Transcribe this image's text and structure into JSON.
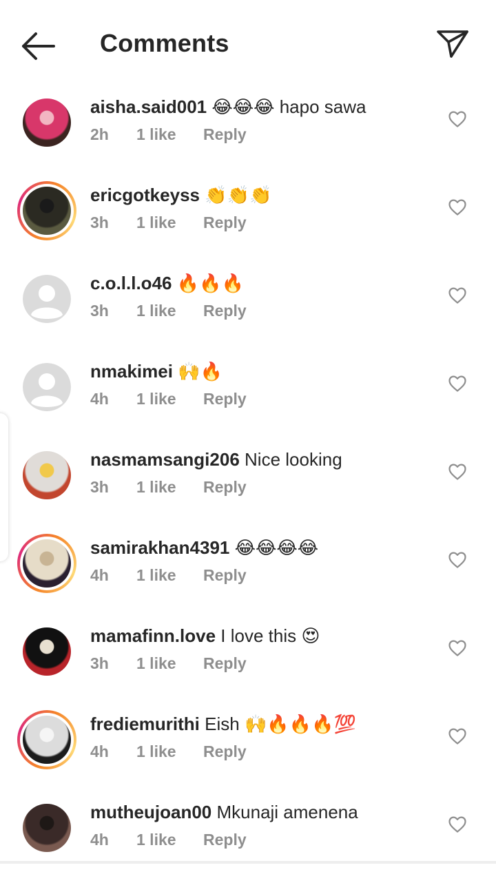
{
  "header": {
    "title": "Comments",
    "back_icon": "arrow-left-icon",
    "send_icon": "send-icon"
  },
  "comments": [
    {
      "username": "aisha.said001",
      "text": "😂😂😂 hapo sawa",
      "time": "2h",
      "likes": "1 like",
      "reply": "Reply",
      "avatar": {
        "story_ring": false,
        "palette": [
          "#d8376a",
          "#3b2420",
          "#f2b6c2"
        ]
      }
    },
    {
      "username": "ericgotkeyss",
      "text": "👏👏👏",
      "time": "3h",
      "likes": "1 like",
      "reply": "Reply",
      "avatar": {
        "story_ring": true,
        "palette": [
          "#2b2a22",
          "#5a5a40",
          "#1a1a1a"
        ]
      }
    },
    {
      "username": "c.o.l.l.o46",
      "text": "🔥🔥🔥",
      "time": "3h",
      "likes": "1 like",
      "reply": "Reply",
      "avatar": {
        "story_ring": false,
        "default": true
      }
    },
    {
      "username": "nmakimei",
      "text": "🙌🔥",
      "time": "4h",
      "likes": "1 like",
      "reply": "Reply",
      "avatar": {
        "story_ring": false,
        "default": true
      }
    },
    {
      "username": "nasmamsangi206",
      "text": "Nice looking",
      "time": "3h",
      "likes": "1 like",
      "reply": "Reply",
      "avatar": {
        "story_ring": false,
        "palette": [
          "#e0dcd8",
          "#c2462e",
          "#f1c94b"
        ]
      }
    },
    {
      "username": "samirakhan4391",
      "text": "😂😂😂😂",
      "time": "4h",
      "likes": "1 like",
      "reply": "Reply",
      "avatar": {
        "story_ring": true,
        "palette": [
          "#e6dcc8",
          "#2a2030",
          "#c8b494"
        ]
      }
    },
    {
      "username": "mamafinn.love",
      "text": "I love this 😍",
      "time": "3h",
      "likes": "1 like",
      "reply": "Reply",
      "avatar": {
        "story_ring": false,
        "palette": [
          "#111111",
          "#b8242a",
          "#e8e0d0"
        ]
      }
    },
    {
      "username": "frediemurithi",
      "text": "Eish 🙌🔥🔥🔥💯",
      "time": "4h",
      "likes": "1 like",
      "reply": "Reply",
      "avatar": {
        "story_ring": true,
        "palette": [
          "#dcdcdc",
          "#1c1c1c",
          "#f5f5f5"
        ]
      }
    },
    {
      "username": "mutheujoan00",
      "text": "Mkunaji amenena",
      "time": "4h",
      "likes": "1 like",
      "reply": "Reply",
      "avatar": {
        "story_ring": false,
        "palette": [
          "#3a2a28",
          "#7a5a50",
          "#1e1816"
        ]
      }
    }
  ],
  "heart_icon": "heart-outline-icon",
  "colors": {
    "text": "#262626",
    "meta": "#8e8e8e",
    "ring_start": "#f58529",
    "ring_mid": "#dd2a7b",
    "default_avatar": "#dbdbdb"
  }
}
